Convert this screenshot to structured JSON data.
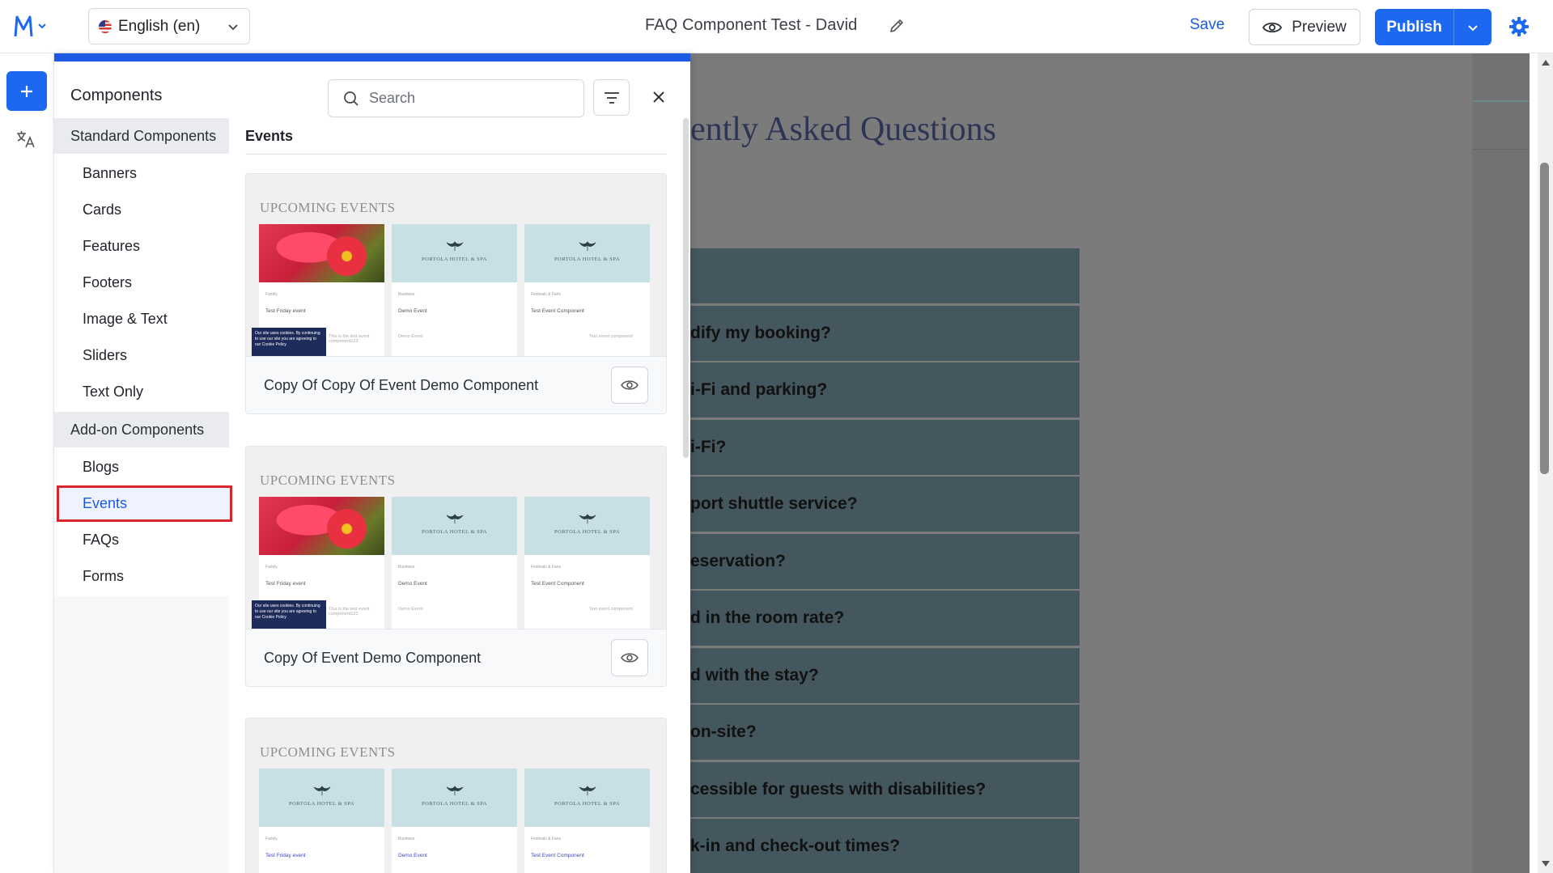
{
  "topbar": {
    "language": "English (en)",
    "page_title": "FAQ Component Test - David",
    "save_label": "Save",
    "preview_label": "Preview",
    "publish_label": "Publish"
  },
  "panel": {
    "title": "Components",
    "search_placeholder": "Search",
    "nav": {
      "standard_label": "Standard Components",
      "standard_items": [
        "Banners",
        "Cards",
        "Features",
        "Footers",
        "Image & Text",
        "Sliders",
        "Text Only"
      ],
      "addon_label": "Add-on Components",
      "addon_items": [
        "Blogs",
        "Events",
        "FAQs",
        "Forms"
      ],
      "active": "Events"
    },
    "list_header": "Events",
    "cards": [
      {
        "name": "Copy Of Copy Of Event Demo Component",
        "thumb_heading": "UPCOMING EVENTS",
        "columns": [
          {
            "tag": "Family",
            "title": "Test Friday event",
            "desc": "This is the test event component123"
          },
          {
            "tag": "Business",
            "title": "Demo Event",
            "desc": "Demo Event"
          },
          {
            "tag": "Festivals & Fairs",
            "title": "Test Event Component",
            "desc": "Test event component"
          }
        ]
      },
      {
        "name": "Copy Of Event Demo Component",
        "thumb_heading": "UPCOMING EVENTS",
        "columns": [
          {
            "tag": "Family",
            "title": "Test Friday event",
            "desc": "This is the test event component123"
          },
          {
            "tag": "Business",
            "title": "Demo Event",
            "desc": "Demo Event"
          },
          {
            "tag": "Festivals & Fairs",
            "title": "Test Event Component",
            "desc": "Test event component"
          }
        ]
      },
      {
        "name": "",
        "thumb_heading": "UPCOMING EVENTS",
        "columns": [
          {
            "tag": "Family",
            "title": "Test Friday event",
            "desc": ""
          },
          {
            "tag": "Business",
            "title": "Demo Event",
            "desc": ""
          },
          {
            "tag": "Festivals & Fairs",
            "title": "Test Event Component",
            "desc": ""
          }
        ]
      }
    ],
    "hotel_mark": "PORTOLA HOTEL & SPA",
    "cookie_text": "Our site uses cookies. By continuing to use our site you are agreeing to our Cookie Policy"
  },
  "canvas": {
    "heading": "ently Asked Questions",
    "faq_items": [
      "",
      "dify my booking?",
      "i-Fi and parking?",
      "i-Fi?",
      "port shuttle service?",
      "eservation?",
      "d in the room rate?",
      "d with the stay?",
      " on-site?",
      "cessible for guests with disabilities?",
      "k-in and check-out times?"
    ]
  },
  "icons": {
    "logo": "m-logo-icon",
    "language": "us-flag-icon",
    "edit": "pencil-icon",
    "preview": "eye-icon",
    "publish_menu": "chevron-down-icon",
    "settings": "gear-icon",
    "add": "plus-icon",
    "translate": "translate-icon",
    "search": "search-icon",
    "filter": "filter-icon",
    "close": "close-icon",
    "card_preview": "eye-icon"
  },
  "colors": {
    "primary": "#1c68f0",
    "active_outline": "#d6262b",
    "faq_row": "#44565e"
  }
}
